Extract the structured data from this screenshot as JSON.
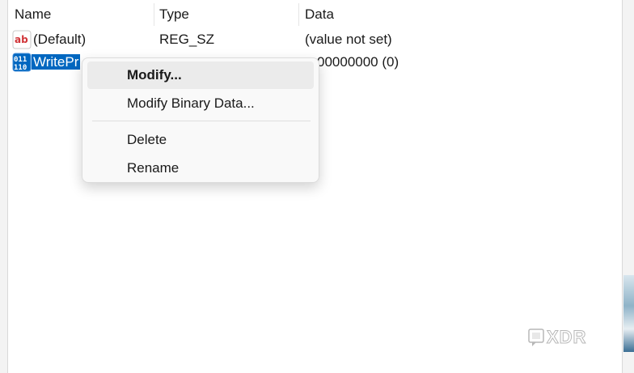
{
  "columns": {
    "name": "Name",
    "type": "Type",
    "data": "Data"
  },
  "rows": [
    {
      "icon": "string-value-icon",
      "name": "(Default)",
      "type": "REG_SZ",
      "data": "(value not set)"
    },
    {
      "icon": "binary-value-icon",
      "name": "WritePr",
      "type": "",
      "data": "00000000 (0)",
      "selected": true
    }
  ],
  "context_menu": {
    "items": [
      {
        "label": "Modify...",
        "default": true
      },
      {
        "label": "Modify Binary Data..."
      },
      {
        "label": "Delete"
      },
      {
        "label": "Rename"
      }
    ]
  },
  "watermark": "XDR",
  "colors": {
    "selection": "#0067c0",
    "menu_bg": "#f9f9f9",
    "menu_hover": "#ebebeb"
  }
}
